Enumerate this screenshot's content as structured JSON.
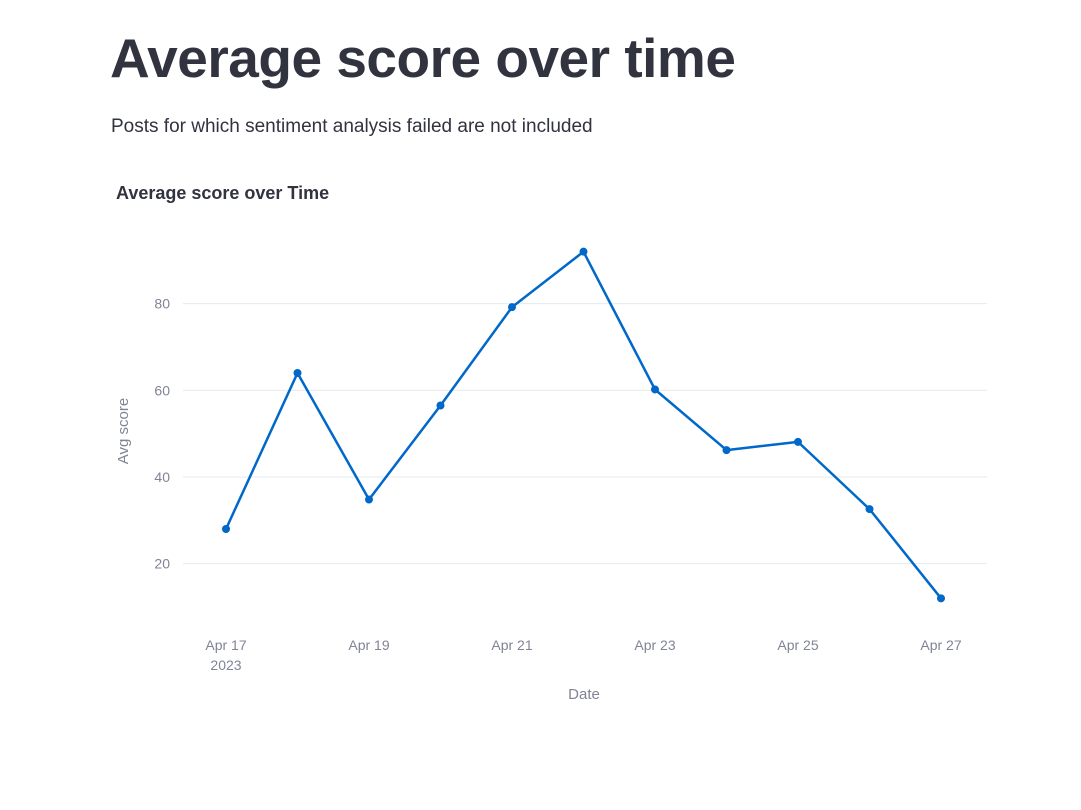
{
  "page": {
    "title": "Average score over time",
    "subtitle": "Posts for which sentiment analysis failed are not included"
  },
  "chart_data": {
    "type": "line",
    "title": "Average score over Time",
    "xlabel": "Date",
    "ylabel": "Avg score",
    "x": [
      "2023-04-17",
      "2023-04-18",
      "2023-04-19",
      "2023-04-20",
      "2023-04-21",
      "2023-04-22",
      "2023-04-23",
      "2023-04-24",
      "2023-04-25",
      "2023-04-26",
      "2023-04-27"
    ],
    "series": [
      {
        "values": [
          28,
          64,
          34.8,
          56.5,
          79.2,
          92,
          60.2,
          46.2,
          48.1,
          32.6,
          12
        ],
        "color": "#0068c9"
      }
    ],
    "x_ticks": [
      {
        "date": "2023-04-17",
        "label": "Apr 17",
        "sublabel": "2023"
      },
      {
        "date": "2023-04-19",
        "label": "Apr 19",
        "sublabel": ""
      },
      {
        "date": "2023-04-21",
        "label": "Apr 21",
        "sublabel": ""
      },
      {
        "date": "2023-04-23",
        "label": "Apr 23",
        "sublabel": ""
      },
      {
        "date": "2023-04-25",
        "label": "Apr 25",
        "sublabel": ""
      },
      {
        "date": "2023-04-27",
        "label": "Apr 27",
        "sublabel": ""
      }
    ],
    "y_ticks": [
      20,
      40,
      60,
      80
    ],
    "ylim": [
      7,
      97
    ],
    "grid": true,
    "legend": "none"
  }
}
